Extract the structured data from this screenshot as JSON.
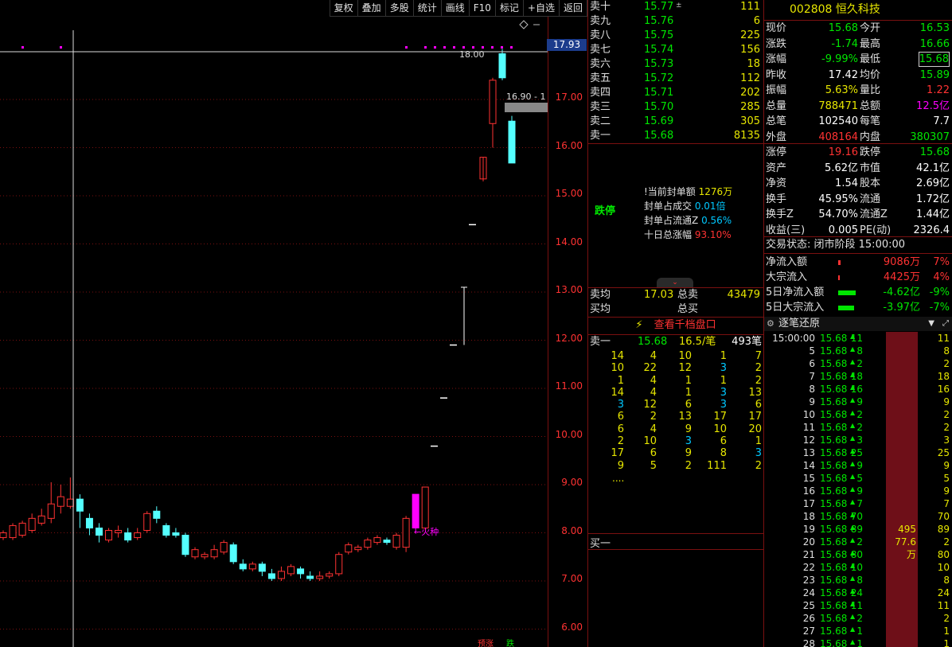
{
  "toolbar": [
    "复权",
    "叠加",
    "多股",
    "统计",
    "画线",
    "F10",
    "标记",
    "+自选",
    "返回"
  ],
  "chart": {
    "price_axis": [
      "17.00",
      "16.00",
      "15.00",
      "14.00",
      "13.00",
      "12.00",
      "11.00",
      "10.00",
      "9.00",
      "8.00",
      "7.00",
      "6.00"
    ],
    "last_price_tag": "17.93",
    "high_marker": "18.00",
    "crosshair_label": "16.90 - 1",
    "annotation": "←火种",
    "bottom_badge_1": "预涨",
    "bottom_badge_2": "跌",
    "colors": {
      "up": "#ff3232",
      "down": "#54ffff",
      "grid": "#7a1010",
      "highlight": "#ff00ff"
    }
  },
  "orderbook": {
    "asks": [
      {
        "label": "卖十",
        "price": "15.77",
        "flag": "±",
        "vol": "111"
      },
      {
        "label": "卖九",
        "price": "15.76",
        "vol": "6"
      },
      {
        "label": "卖八",
        "price": "15.75",
        "vol": "225"
      },
      {
        "label": "卖七",
        "price": "15.74",
        "vol": "156"
      },
      {
        "label": "卖六",
        "price": "15.73",
        "vol": "18"
      },
      {
        "label": "卖五",
        "price": "15.72",
        "vol": "112"
      },
      {
        "label": "卖四",
        "price": "15.71",
        "vol": "202"
      },
      {
        "label": "卖三",
        "price": "15.70",
        "vol": "285"
      },
      {
        "label": "卖二",
        "price": "15.69",
        "vol": "305"
      },
      {
        "label": "卖一",
        "price": "15.68",
        "vol": "8135"
      }
    ],
    "limit": {
      "label": "跌停",
      "rows": [
        {
          "k": "!当前封单额",
          "v": "1276万",
          "cls": "yellow"
        },
        {
          "k": "封单占成交",
          "v": "0.01倍",
          "cls": "cyan"
        },
        {
          "k": "封单占流通Z",
          "v": "0.56%",
          "cls": "cyan"
        },
        {
          "k": "十日总涨幅",
          "v": "93.10%",
          "cls": "red"
        }
      ]
    },
    "avg": {
      "sell_avg_label": "卖均",
      "sell_avg": "17.03",
      "sell_total_label": "总卖",
      "sell_total": "43479",
      "buy_avg_label": "买均",
      "buy_total_label": "总买"
    },
    "depth_button": "查看千档盘口",
    "queue": {
      "head_label": "卖一",
      "head_price": "15.68",
      "head_per": "16.5/笔",
      "head_count": "493笔",
      "rows": [
        [
          "14",
          "4",
          "10",
          "1",
          "7"
        ],
        [
          "10",
          "22",
          "12",
          "3",
          "2"
        ],
        [
          "1",
          "4",
          "1",
          "1",
          "2"
        ],
        [
          "14",
          "4",
          "1",
          "3",
          "13"
        ],
        [
          "3",
          "12",
          "6",
          "3",
          "6"
        ],
        [
          "6",
          "2",
          "13",
          "17",
          "17"
        ],
        [
          "6",
          "4",
          "9",
          "10",
          "20"
        ],
        [
          "2",
          "10",
          "3",
          "6",
          "1"
        ],
        [
          "17",
          "6",
          "9",
          "8",
          "3"
        ],
        [
          "9",
          "5",
          "2",
          "111",
          "2"
        ]
      ],
      "more": "....",
      "buy1_label": "买一"
    }
  },
  "info": {
    "code": "002808",
    "name": "恒久科技",
    "quote": [
      {
        "k1": "现价",
        "v1": "15.68",
        "c1": "green",
        "k2": "今开",
        "v2": "16.53",
        "c2": "green"
      },
      {
        "k1": "涨跌",
        "v1": "-1.74",
        "c1": "green",
        "k2": "最高",
        "v2": "16.66",
        "c2": "green"
      },
      {
        "k1": "涨幅",
        "v1": "-9.99%",
        "c1": "green",
        "k2": "最低",
        "v2": "15.68",
        "c2": "green",
        "box2": true
      },
      {
        "k1": "昨收",
        "v1": "17.42",
        "c1": "white",
        "k2": "均价",
        "v2": "15.89",
        "c2": "green"
      },
      {
        "k1": "振幅",
        "v1": "5.63%",
        "c1": "yellow",
        "k2": "量比",
        "v2": "1.22",
        "c2": "red"
      },
      {
        "k1": "总量",
        "v1": "788471",
        "c1": "yellow",
        "k2": "总额",
        "v2": "12.5亿",
        "c2": "magenta"
      },
      {
        "k1": "总笔",
        "v1": "102540",
        "c1": "white",
        "k2": "每笔",
        "v2": "7.7",
        "c2": "white"
      },
      {
        "k1": "外盘",
        "v1": "408164",
        "c1": "red",
        "k2": "内盘",
        "v2": "380307",
        "c2": "green"
      }
    ],
    "fundamentals": [
      {
        "k1": "涨停",
        "v1": "19.16",
        "c1": "red",
        "k2": "跌停",
        "v2": "15.68",
        "c2": "green"
      },
      {
        "k1": "资产",
        "v1": "5.62亿",
        "c1": "white",
        "k2": "市值",
        "v2": "42.1亿",
        "c2": "white"
      },
      {
        "k1": "净资",
        "v1": "1.54",
        "c1": "white",
        "k2": "股本",
        "v2": "2.69亿",
        "c2": "white"
      },
      {
        "k1": "换手",
        "v1": "45.95%",
        "c1": "white",
        "k2": "流通",
        "v2": "1.72亿",
        "c2": "white"
      },
      {
        "k1": "换手Z",
        "v1": "54.70%",
        "c1": "white",
        "k2": "流通Z",
        "v2": "1.44亿",
        "c2": "white"
      },
      {
        "k1": "收益(三)",
        "v1": "0.005",
        "c1": "white",
        "k2": "PE(动)",
        "v2": "2326.4",
        "c2": "white"
      }
    ],
    "trade_status": "交易状态: 闭市阶段 15:00:00",
    "flows": [
      {
        "k": "净流入额",
        "v": "9086万",
        "p": "7%",
        "cls": "red",
        "bar_color": "#ff3232",
        "bar_w": 3
      },
      {
        "k": "大宗流入",
        "v": "4425万",
        "p": "4%",
        "cls": "red",
        "bar_color": "#ff3232",
        "bar_w": 2
      },
      {
        "k": "5日净流入额",
        "v": "-4.62亿",
        "p": "-9%",
        "cls": "green",
        "bar_color": "#00e600",
        "bar_w": 22
      },
      {
        "k": "5日大宗流入",
        "v": "-3.97亿",
        "p": "-7%",
        "cls": "green",
        "bar_color": "#00e600",
        "bar_w": 20
      }
    ],
    "tick_title": "逐笔还原",
    "ticks": [
      {
        "t": "15:00:00",
        "p": "15.68",
        "v": "11",
        "big": "",
        "r": "11"
      },
      {
        "t": "5",
        "p": "15.68",
        "v": "8",
        "big": "",
        "r": "8"
      },
      {
        "t": "6",
        "p": "15.68",
        "v": "2",
        "big": "",
        "r": "2"
      },
      {
        "t": "7",
        "p": "15.68",
        "v": "18",
        "big": "",
        "r": "18"
      },
      {
        "t": "8",
        "p": "15.68",
        "v": "16",
        "big": "",
        "r": "16"
      },
      {
        "t": "9",
        "p": "15.68",
        "v": "9",
        "big": "",
        "r": "9"
      },
      {
        "t": "10",
        "p": "15.68",
        "v": "2",
        "big": "",
        "r": "2"
      },
      {
        "t": "11",
        "p": "15.68",
        "v": "2",
        "big": "",
        "r": "2"
      },
      {
        "t": "12",
        "p": "15.68",
        "v": "3",
        "big": "",
        "r": "3"
      },
      {
        "t": "13",
        "p": "15.68",
        "v": "25",
        "big": "",
        "r": "25"
      },
      {
        "t": "14",
        "p": "15.68",
        "v": "9",
        "big": "",
        "r": "9"
      },
      {
        "t": "15",
        "p": "15.68",
        "v": "5",
        "big": "",
        "r": "5"
      },
      {
        "t": "16",
        "p": "15.68",
        "v": "9",
        "big": "",
        "r": "9"
      },
      {
        "t": "17",
        "p": "15.68",
        "v": "7",
        "big": "",
        "r": "7"
      },
      {
        "t": "18",
        "p": "15.68",
        "v": "70",
        "big": "",
        "r": "70"
      },
      {
        "t": "19",
        "p": "15.68",
        "v": "89",
        "big": "495",
        "r": "89"
      },
      {
        "t": "20",
        "p": "15.68",
        "v": "2",
        "big": "77.6万",
        "r": "2"
      },
      {
        "t": "21",
        "p": "15.68",
        "v": "80",
        "big": "",
        "r": "80"
      },
      {
        "t": "22",
        "p": "15.68",
        "v": "10",
        "big": "",
        "r": "10"
      },
      {
        "t": "23",
        "p": "15.68",
        "v": "8",
        "big": "",
        "r": "8"
      },
      {
        "t": "24",
        "p": "15.68",
        "v": "24",
        "big": "",
        "r": "24"
      },
      {
        "t": "25",
        "p": "15.68",
        "v": "11",
        "big": "",
        "r": "11"
      },
      {
        "t": "26",
        "p": "15.68",
        "v": "2",
        "big": "",
        "r": "2"
      },
      {
        "t": "27",
        "p": "15.68",
        "v": "1",
        "big": "",
        "r": "1"
      },
      {
        "t": "28",
        "p": "15.68",
        "v": "1",
        "big": "",
        "r": "1"
      }
    ]
  }
}
